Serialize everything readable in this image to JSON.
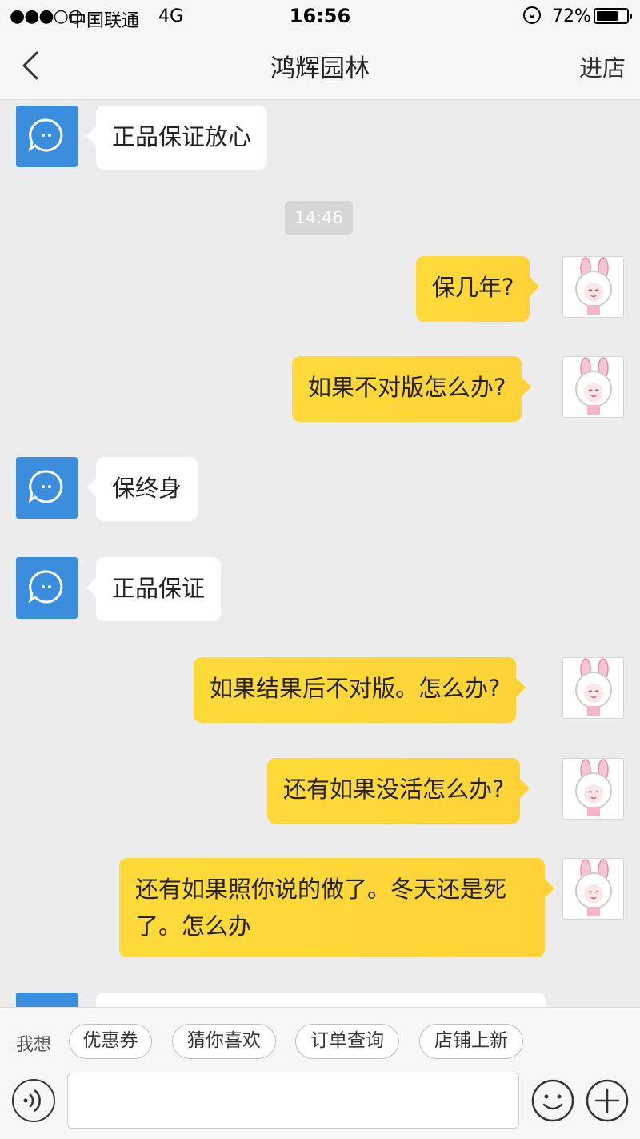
{
  "status_bar": {
    "signal": "●●●○○",
    "carrier": "中国联通",
    "network": "4G",
    "time": "16:56",
    "battery_percent": "72%",
    "battery_level": 0.72
  },
  "nav": {
    "title": "鸿辉园林",
    "enter_store": "进店"
  },
  "chat": {
    "timestamp": "14:46",
    "messages": [
      {
        "from": "shop",
        "text": "正品保证放心"
      },
      {
        "from": "user",
        "text": "保几年?"
      },
      {
        "from": "user",
        "text": "如果不对版怎么办?"
      },
      {
        "from": "shop",
        "text": "保终身"
      },
      {
        "from": "shop",
        "text": "正品保证"
      },
      {
        "from": "user",
        "text": "如果结果后不对版。怎么办?"
      },
      {
        "from": "user",
        "text": "还有如果没活怎么办?"
      },
      {
        "from": "user",
        "text": "还有如果照你说的做了。冬天还是死了。怎么办"
      }
    ]
  },
  "quick_bar": {
    "label": "我想",
    "chips": [
      "优惠券",
      "猜你喜欢",
      "订单查询",
      "店铺上新"
    ]
  },
  "input_bar": {
    "placeholder": ""
  },
  "colors": {
    "shop_avatar": "#3b8ede",
    "user_bubble": "#ffd338",
    "background": "#ececec"
  }
}
